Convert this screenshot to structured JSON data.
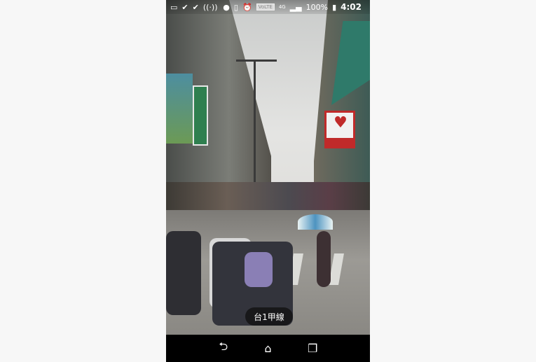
{
  "status_bar": {
    "left_icons": [
      "keyboard-icon",
      "check-icon",
      "check-icon",
      "signal-waves-icon"
    ],
    "right_icons": [
      "location-pin-icon",
      "vibrate-icon",
      "alarm-icon"
    ],
    "volte": "VoLTE",
    "network": "4G",
    "battery": "100%",
    "time": "4:02"
  },
  "street_view": {
    "road_label": "台1甲線"
  },
  "nav_bar": {
    "back": "⮌",
    "home": "⌂",
    "recents": "❐"
  }
}
